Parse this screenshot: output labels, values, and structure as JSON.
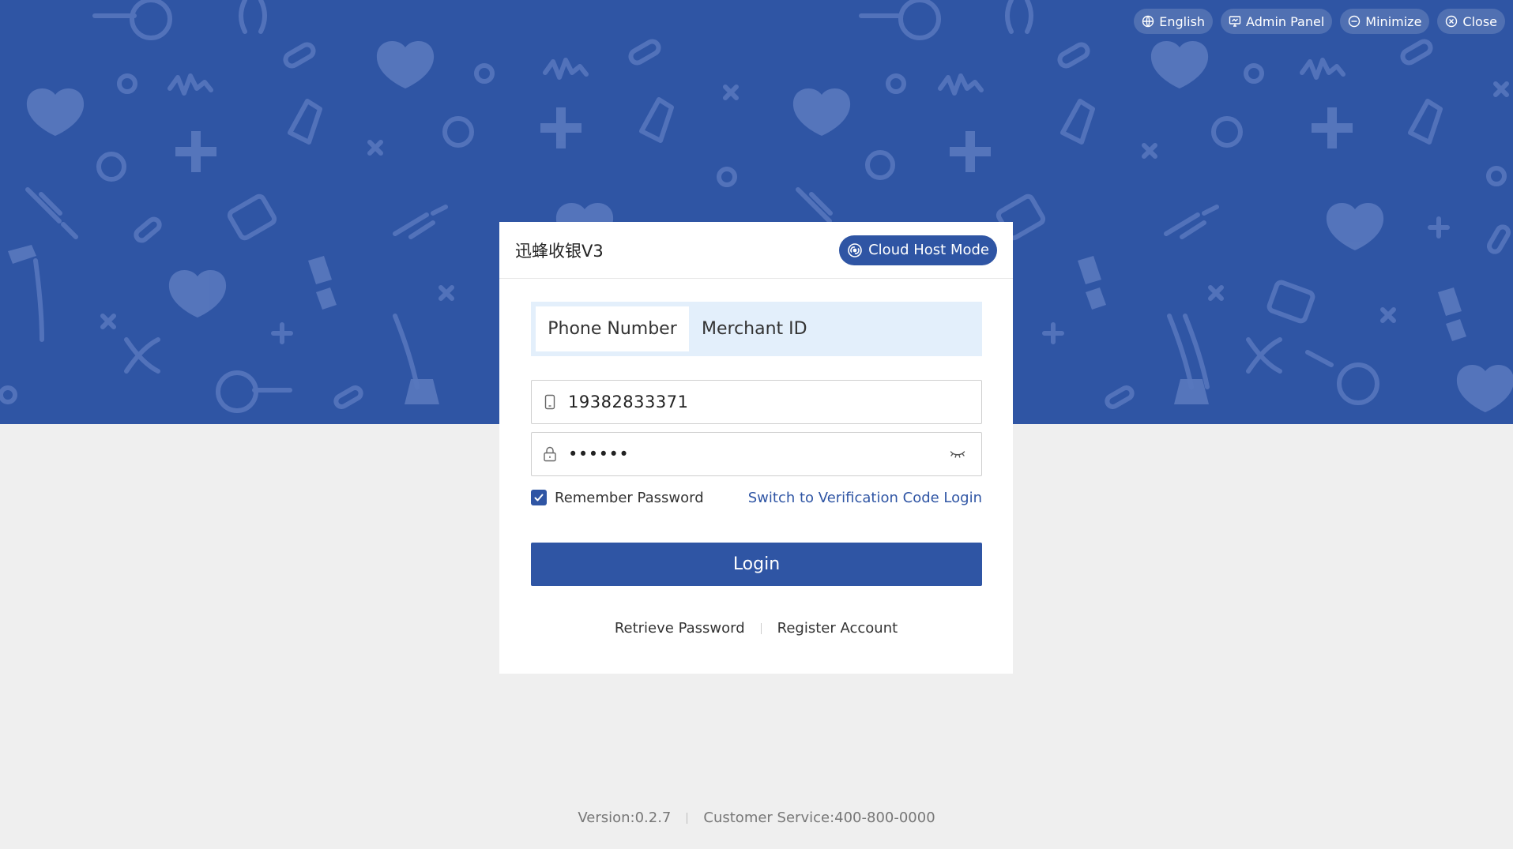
{
  "window_controls": {
    "language": {
      "label": "English",
      "icon": "globe-icon"
    },
    "admin": {
      "label": "Admin Panel",
      "icon": "monitor-icon"
    },
    "minimize": {
      "label": "Minimize",
      "icon": "minus-circle-icon"
    },
    "close": {
      "label": "Close",
      "icon": "close-circle-icon"
    }
  },
  "card": {
    "app_title": "迅蜂收银V3",
    "mode_button": {
      "label": "Cloud Host Mode",
      "icon": "cloud-host-icon"
    }
  },
  "login_tabs": [
    {
      "label": "Phone Number",
      "active": true
    },
    {
      "label": "Merchant ID",
      "active": false
    }
  ],
  "phone_input": {
    "value": "19382833371",
    "icon": "phone-icon"
  },
  "password_input": {
    "value": "••••••",
    "icon": "lock-icon",
    "toggle_icon": "eye-closed-icon"
  },
  "remember_password": {
    "label": "Remember Password",
    "checked": true
  },
  "switch_login_link": "Switch to Verification Code Login",
  "login_button": "Login",
  "bottom_links": {
    "retrieve": "Retrieve Password",
    "register": "Register Account"
  },
  "footer": {
    "version": "Version:0.2.7",
    "service": "Customer Service:400-800-0000"
  },
  "colors": {
    "primary": "#2f55a4",
    "tab_background": "#e3effb",
    "page_background": "#efefef"
  }
}
